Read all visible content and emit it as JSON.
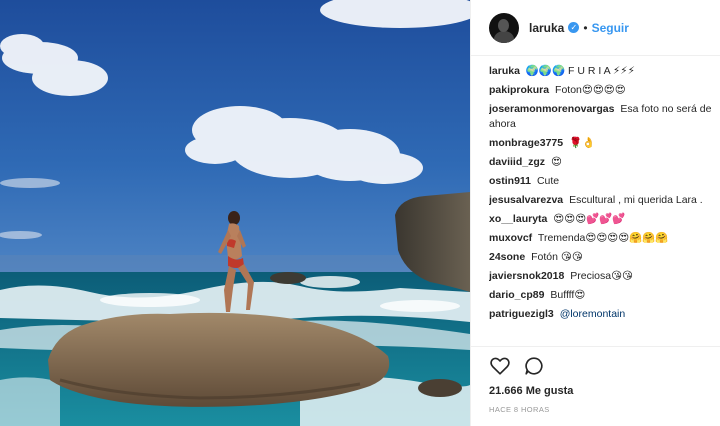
{
  "header": {
    "username": "laruka",
    "verified_mark": "✓",
    "separator": "•",
    "follow_label": "Seguir"
  },
  "comments": [
    {
      "user": "laruka",
      "text": "🌍🌍🌍 F U R I A ⚡⚡⚡"
    },
    {
      "user": "pakiprokura",
      "text": "Foton😍😍😍😍"
    },
    {
      "user": "joseramonmorenovargas",
      "text": "Esa foto no será de ahora"
    },
    {
      "user": "monbrage3775",
      "text": "🌹👌"
    },
    {
      "user": "daviiid_zgz",
      "text": "😍"
    },
    {
      "user": "ostin911",
      "text": "Cute"
    },
    {
      "user": "jesusalvarezva",
      "text": "Escultural , mi querida Lara ."
    },
    {
      "user": "xo__lauryta",
      "text": "😍😍😍💕💕💕"
    },
    {
      "user": "muxovcf",
      "text": "Tremenda😍😍😍😍🤗🤗🤗"
    },
    {
      "user": "24sone",
      "text": "Fotón 😘😘"
    },
    {
      "user": "javiersnok2018",
      "text": "Preciosa😘😘"
    },
    {
      "user": "dario_cp89",
      "text": "Buffff😍"
    },
    {
      "user": "patriguezigl3",
      "text": "@loremontain"
    }
  ],
  "actions": {
    "like_icon": "heart-outline-icon",
    "comment_icon": "comment-bubble-icon",
    "likes_text": "21.666 Me gusta",
    "time_text": "HACE 8 HORAS"
  },
  "colors": {
    "accent": "#3897f0",
    "mention": "#003569",
    "muted": "#999999",
    "sky_top": "#1d4f9e",
    "sea": "#0f6f86"
  }
}
